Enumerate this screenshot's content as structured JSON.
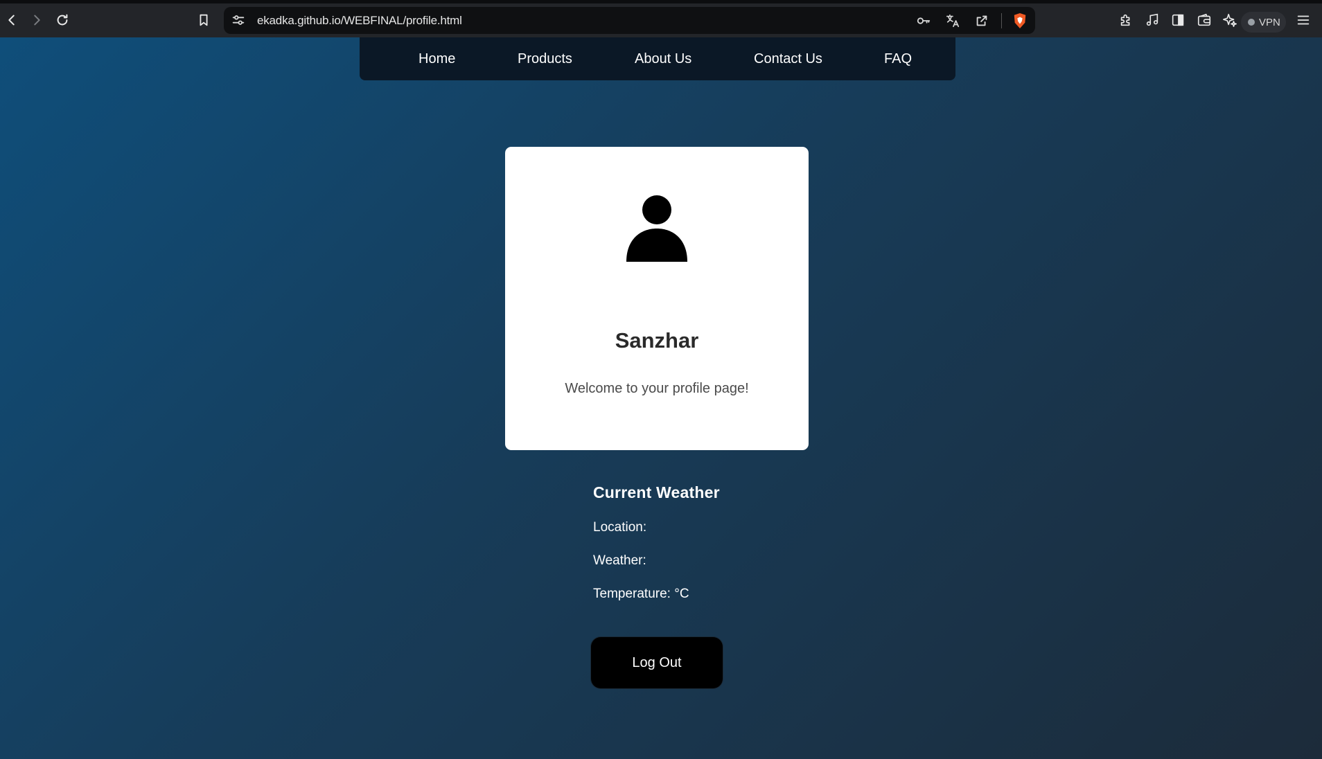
{
  "browser": {
    "url": "ekadka.github.io/WEBFINAL/profile.html",
    "vpn_label": "VPN",
    "icons": {
      "back": "back-arrow-icon",
      "forward": "forward-arrow-icon",
      "reload": "reload-icon",
      "bookmark": "bookmark-icon",
      "site_settings": "site-settings-icon",
      "password_key": "key-icon",
      "translate": "translate-icon",
      "share": "share-icon",
      "shields": "brave-shield-icon",
      "extensions": "puzzle-icon",
      "media": "music-note-icon",
      "sidebar": "sidebar-icon",
      "wallet": "wallet-icon",
      "leo": "sparkle-icon",
      "menu": "hamburger-menu-icon"
    }
  },
  "nav": {
    "items": [
      {
        "label": "Home"
      },
      {
        "label": "Products"
      },
      {
        "label": "About Us"
      },
      {
        "label": "Contact Us"
      },
      {
        "label": "FAQ"
      }
    ]
  },
  "profile": {
    "avatar_icon": "user-avatar-icon",
    "name": "Sanzhar",
    "welcome": "Welcome to your profile page!"
  },
  "weather": {
    "title": "Current Weather",
    "location_label": "Location:",
    "weather_label": "Weather:",
    "temperature_label": "Temperature: °C"
  },
  "actions": {
    "logout_label": "Log Out"
  },
  "colors": {
    "gradient_start": "#0f4e7a",
    "gradient_end": "#1c2b3a",
    "navbar_bg": "#0b1826",
    "card_bg": "#ffffff",
    "button_bg": "#000000"
  }
}
